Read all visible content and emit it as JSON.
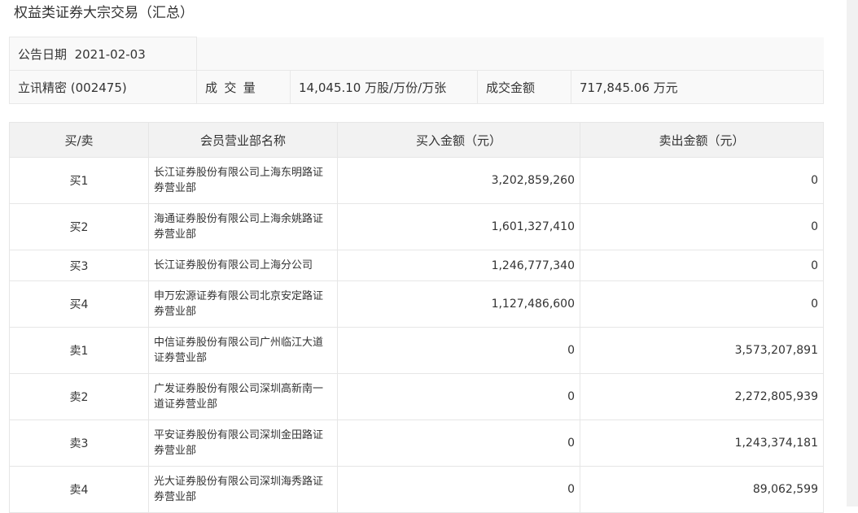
{
  "page": {
    "title": "权益类证券大宗交易（汇总）"
  },
  "summary": {
    "date_label": "公告日期",
    "date_value": "2021-02-03",
    "stock": "立讯精密 (002475)",
    "volume_label": "成 交 量",
    "volume_value": "14,045.10 万股/万份/万张",
    "amount_label": "成交金额",
    "amount_value": "717,845.06 万元"
  },
  "table": {
    "headers": [
      "买/卖",
      "会员营业部名称",
      "买入金额（元）",
      "卖出金额（元）"
    ],
    "rows": [
      {
        "side": "买1",
        "branch": "长江证券股份有限公司上海东明路证券营业部",
        "buy": "3,202,859,260",
        "sell": "0"
      },
      {
        "side": "买2",
        "branch": "海通证券股份有限公司上海余姚路证券营业部",
        "buy": "1,601,327,410",
        "sell": "0"
      },
      {
        "side": "买3",
        "branch": "长江证券股份有限公司上海分公司",
        "buy": "1,246,777,340",
        "sell": "0"
      },
      {
        "side": "买4",
        "branch": "申万宏源证券有限公司北京安定路证券营业部",
        "buy": "1,127,486,600",
        "sell": "0"
      },
      {
        "side": "卖1",
        "branch": "中信证券股份有限公司广州临江大道证券营业部",
        "buy": "0",
        "sell": "3,573,207,891"
      },
      {
        "side": "卖2",
        "branch": "广发证券股份有限公司深圳高新南一道证券营业部",
        "buy": "0",
        "sell": "2,272,805,939"
      },
      {
        "side": "卖3",
        "branch": "平安证券股份有限公司深圳金田路证券营业部",
        "buy": "0",
        "sell": "1,243,374,181"
      },
      {
        "side": "卖4",
        "branch": "光大证券股份有限公司深圳海秀路证券营业部",
        "buy": "0",
        "sell": "89,062,599"
      }
    ]
  }
}
